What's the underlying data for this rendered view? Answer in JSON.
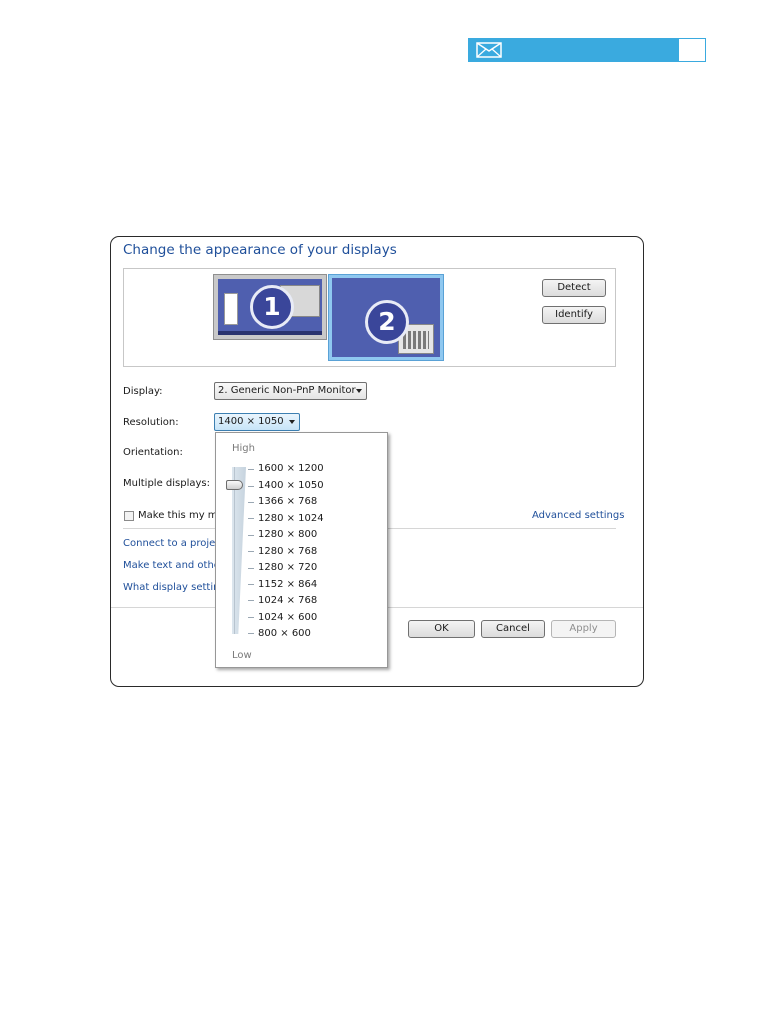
{
  "header": {
    "mail_icon": "envelope-icon",
    "accent": "#3aaadf"
  },
  "dialog": {
    "title": "Change the appearance of your displays",
    "monitors": [
      {
        "number": "1"
      },
      {
        "number": "2"
      }
    ],
    "detect_label": "Detect",
    "identify_label": "Identify",
    "display_label": "Display:",
    "display_value": "2. Generic Non-PnP Monitor",
    "resolution_label": "Resolution:",
    "resolution_value": "1400 × 1050",
    "orientation_label": "Orientation:",
    "multiple_label": "Multiple displays:",
    "main_display_checkbox": "Make this my ma",
    "advanced_link": "Advanced settings",
    "links": [
      "Connect to a projec",
      "Make text and other",
      "What display setting"
    ],
    "ok_label": "OK",
    "cancel_label": "Cancel",
    "apply_label": "Apply"
  },
  "dropdown": {
    "high_label": "High",
    "low_label": "Low",
    "options": [
      "1600 × 1200",
      "1400 × 1050",
      "1366 × 768",
      "1280 × 1024",
      "1280 × 800",
      "1280 × 768",
      "1280 × 720",
      "1152 × 864",
      "1024 × 768",
      "1024 × 600",
      "800 × 600"
    ],
    "selected": "1400 × 1050"
  }
}
